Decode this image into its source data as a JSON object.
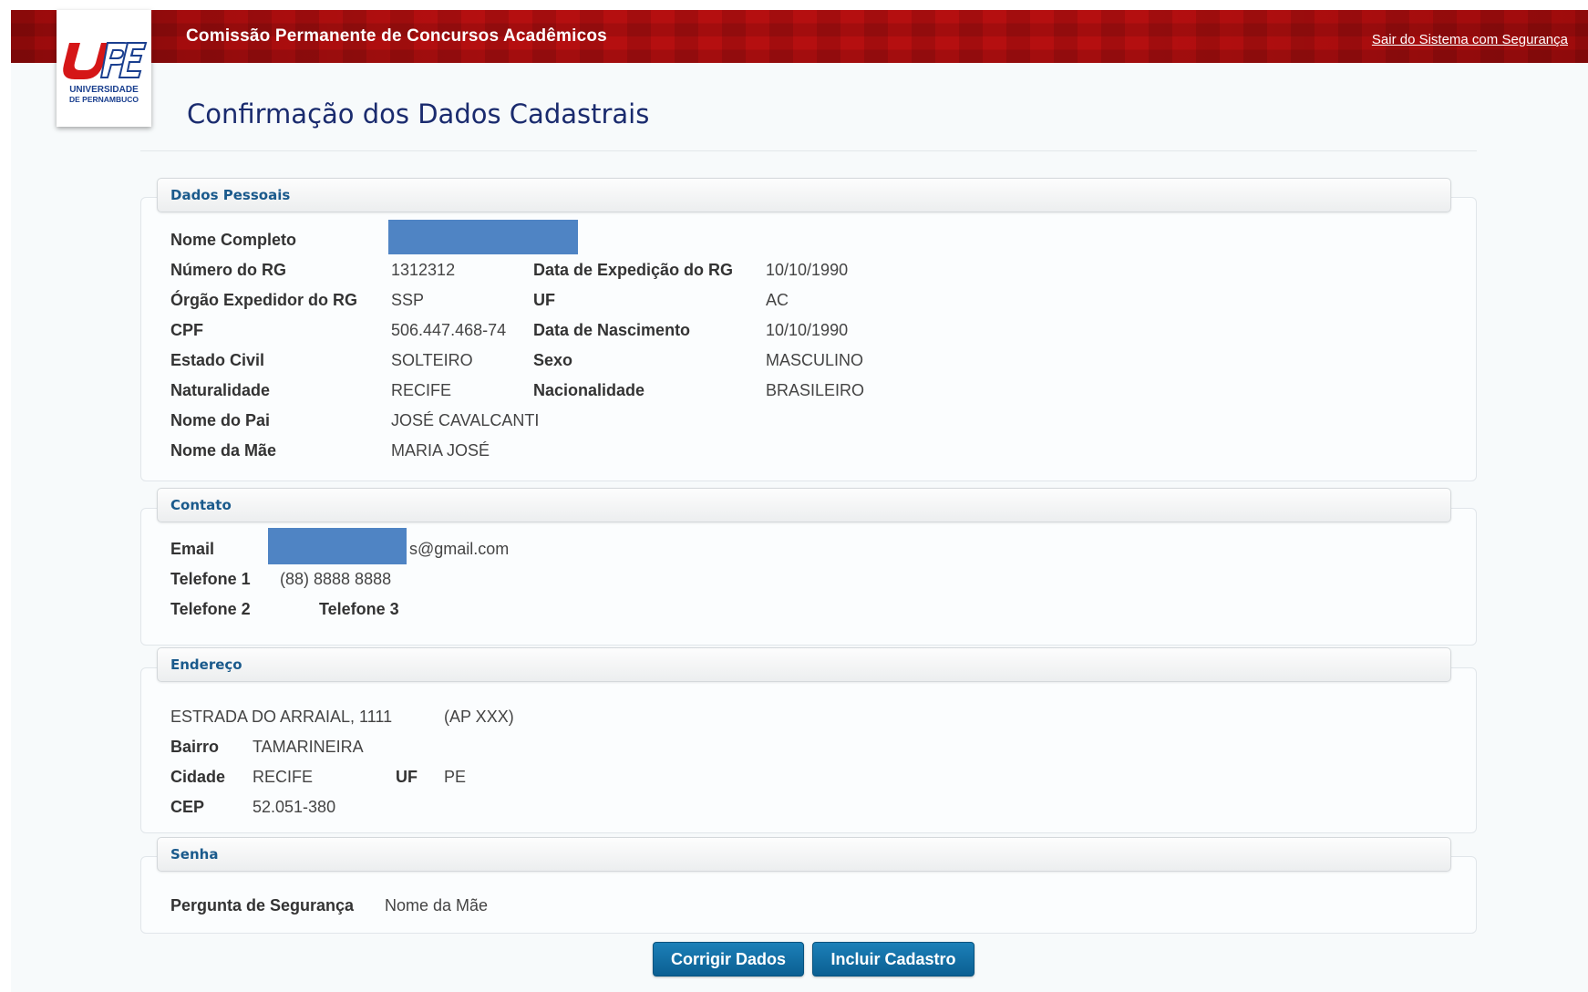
{
  "header": {
    "logo_text": [
      "UNIVERSIDADE",
      "DE PERNAMBUCO"
    ],
    "title": "Comissão Permanente de Concursos Acadêmicos",
    "logout_link": "Sair do Sistema com Segurança",
    "colors": {
      "header_red": "#b50f10",
      "title_blue": "#1a2b6e",
      "button_blue": "#0f6ea3",
      "section_blue": "#1a5a8c",
      "redaction": "#4f84c4"
    }
  },
  "page_title": "Confirmação dos Dados Cadastrais",
  "personal": {
    "heading": "Dados Pessoais",
    "nome_completo_label": "Nome Completo",
    "rg_label": "Número do RG",
    "rg_value": "1312312",
    "exp_date_label": "Data de Expedição do RG",
    "exp_date_value": "10/10/1990",
    "orgao_label": "Órgão Expedidor do RG",
    "orgao_value": "SSP",
    "uf_label": "UF",
    "uf_value": "AC",
    "cpf_label": "CPF",
    "cpf_value": "506.447.468-74",
    "birth_label": "Data de Nascimento",
    "birth_value": "10/10/1990",
    "civil_label": "Estado Civil",
    "civil_value": "SOLTEIRO",
    "sex_label": "Sexo",
    "sex_value": "MASCULINO",
    "nat_label": "Naturalidade",
    "nat_value": "RECIFE",
    "nac_label": "Nacionalidade",
    "nac_value": "BRASILEIRO",
    "father_label": "Nome do Pai",
    "father_value": "JOSÉ CAVALCANTI",
    "mother_label": "Nome da Mãe",
    "mother_value": "MARIA JOSÉ"
  },
  "contact": {
    "heading": "Contato",
    "email_label": "Email",
    "email_value_visible": "s@gmail.com",
    "phone1_label": "Telefone 1",
    "phone1_value": "(88) 8888 8888",
    "phone2_label": "Telefone 2",
    "phone3_label": "Telefone 3"
  },
  "address": {
    "heading": "Endereço",
    "street": "ESTRADA DO ARRAIAL, 1111",
    "complement": "(AP XXX)",
    "bairro_label": "Bairro",
    "bairro_value": "TAMARINEIRA",
    "cidade_label": "Cidade",
    "cidade_value": "RECIFE",
    "uf_label": "UF",
    "uf_value": "PE",
    "cep_label": "CEP",
    "cep_value": "52.051-380"
  },
  "password": {
    "heading": "Senha",
    "question_label": "Pergunta de Segurança",
    "question_value": "Nome da Mãe"
  },
  "buttons": {
    "correct": "Corrigir Dados",
    "submit": "Incluir Cadastro"
  }
}
